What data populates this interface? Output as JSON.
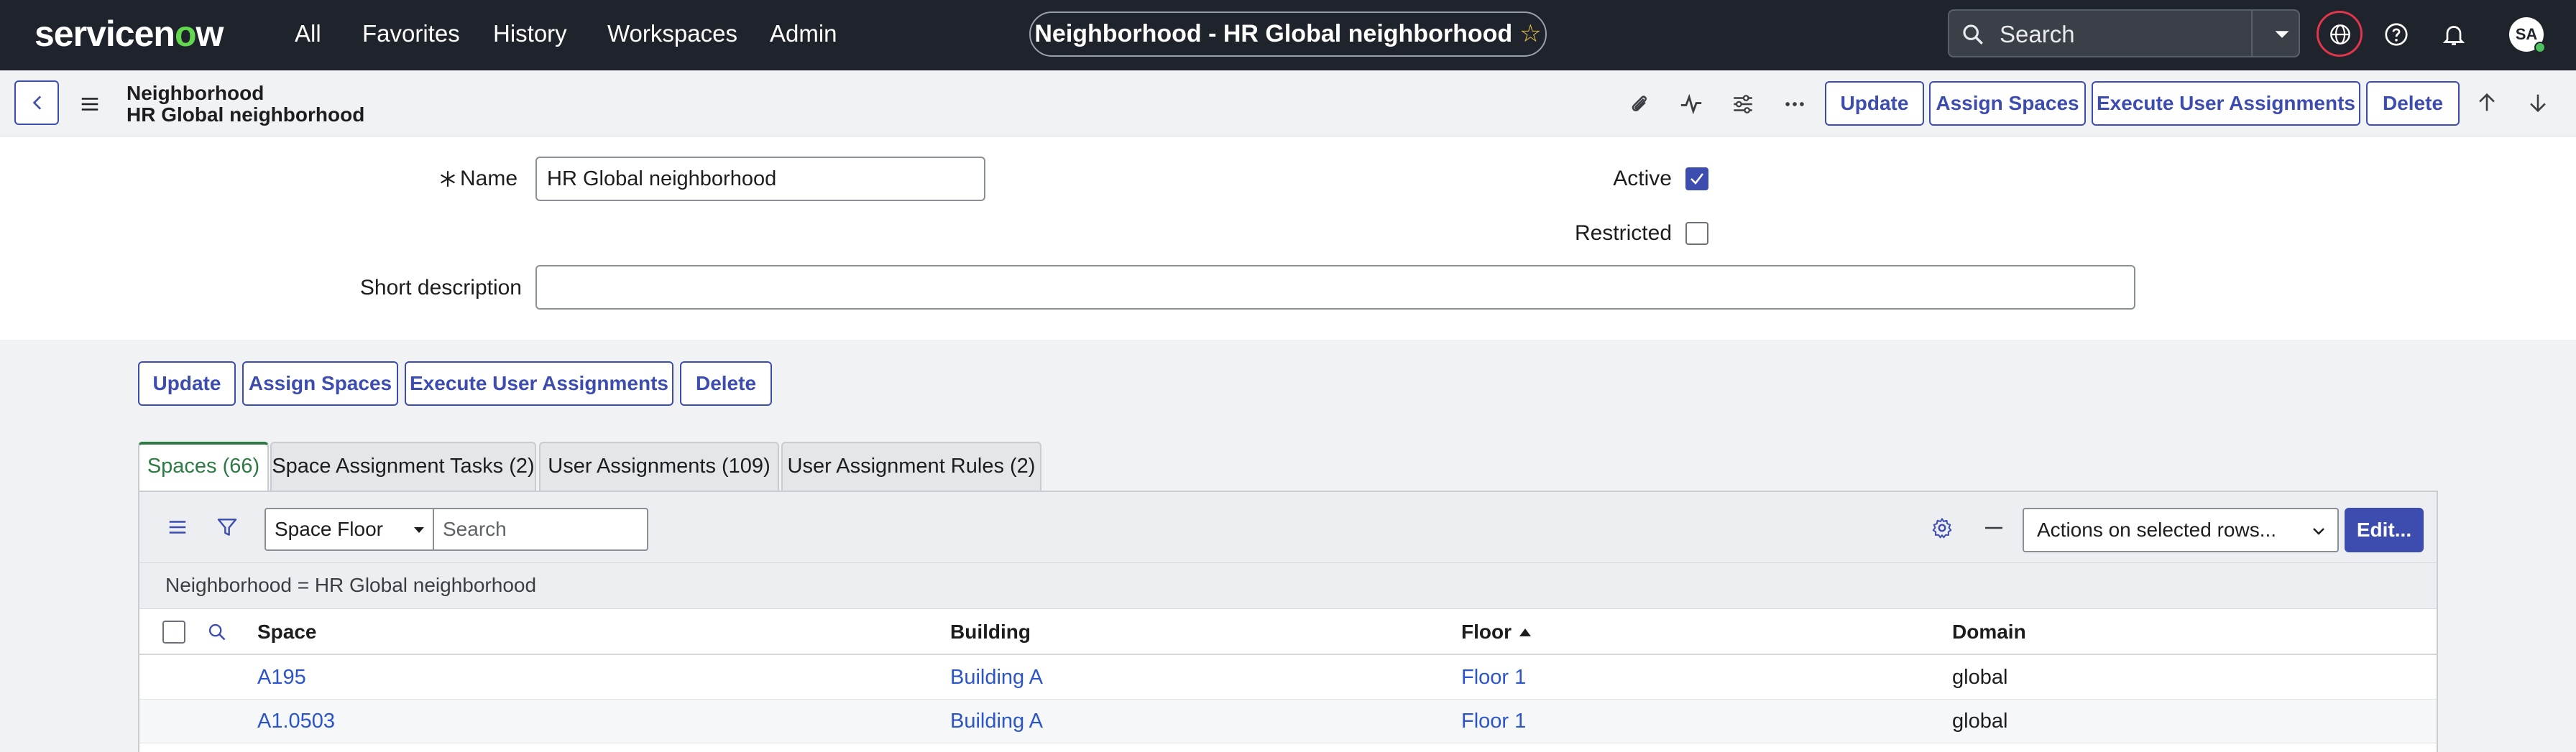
{
  "topnav": {
    "logo_prefix": "servicen",
    "logo_o": "o",
    "logo_suffix": "w",
    "links": [
      "All",
      "Favorites",
      "History",
      "Workspaces",
      "Admin"
    ],
    "record_pill": "Neighborhood - HR Global neighborhood",
    "search_placeholder": "Search",
    "avatar_initials": "SA"
  },
  "form_header": {
    "table_name": "Neighborhood",
    "record_name": "HR Global neighborhood",
    "buttons": {
      "update": "Update",
      "assign_spaces": "Assign Spaces",
      "execute_user_assignments": "Execute User Assignments",
      "delete": "Delete"
    }
  },
  "form": {
    "name_label": "Name",
    "name_value": "HR Global neighborhood",
    "active_label": "Active",
    "active_checked": true,
    "restricted_label": "Restricted",
    "restricted_checked": false,
    "short_description_label": "Short description",
    "short_description_value": ""
  },
  "bottom_buttons": {
    "update": "Update",
    "assign_spaces": "Assign Spaces",
    "execute_user_assignments": "Execute User Assignments",
    "delete": "Delete"
  },
  "tabs": [
    {
      "label": "Spaces (66)",
      "active": true
    },
    {
      "label": "Space Assignment Tasks (2)",
      "active": false
    },
    {
      "label": "User Assignments (109)",
      "active": false
    },
    {
      "label": "User Assignment Rules (2)",
      "active": false
    }
  ],
  "list": {
    "search_field": "Space Floor",
    "search_placeholder": "Search",
    "actions_select": "Actions on selected rows...",
    "edit_label": "Edit...",
    "breadcrumb": "Neighborhood = HR Global neighborhood",
    "columns": [
      "Space",
      "Building",
      "Floor",
      "Domain"
    ],
    "rows": [
      {
        "space": "A195",
        "building": "Building A",
        "floor": "Floor 1",
        "domain": "global"
      },
      {
        "space": "A1.0503",
        "building": "Building A",
        "floor": "Floor 1",
        "domain": "global"
      }
    ]
  },
  "colors": {
    "nav_bg": "#1f232b",
    "accent": "#3c4caf",
    "active_tab": "#2d7a45",
    "link": "#2b55c8"
  }
}
